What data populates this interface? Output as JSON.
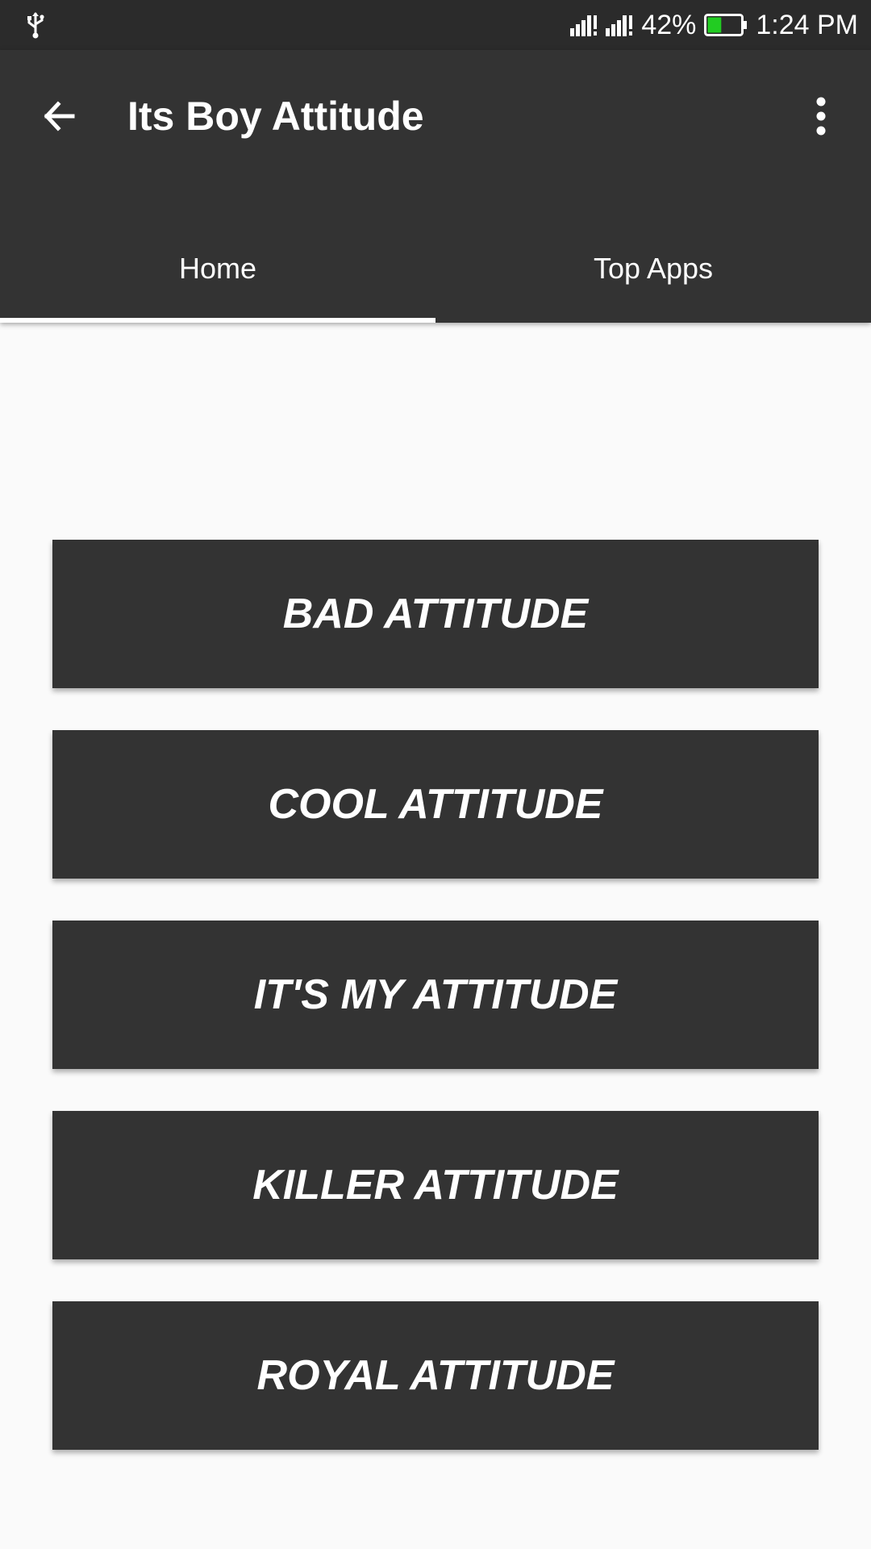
{
  "status_bar": {
    "usb_icon": "usb-icon",
    "signal_icons": [
      "signal-sim1-icon",
      "signal-sim2-icon"
    ],
    "battery_percent": "42%",
    "battery_icon": "battery-icon",
    "battery_level": 0.42,
    "battery_color": "#22cc22",
    "time": "1:24 PM"
  },
  "app_bar": {
    "title": "Its Boy Attitude",
    "back_icon": "arrow-back-icon",
    "menu_icon": "more-vert-icon",
    "background": "#333333"
  },
  "tabs": [
    {
      "label": "Home",
      "selected": true
    },
    {
      "label": "Top Apps",
      "selected": false
    }
  ],
  "buttons": [
    {
      "label": "BAD ATTITUDE"
    },
    {
      "label": "COOL ATTITUDE"
    },
    {
      "label": "IT'S MY ATTITUDE"
    },
    {
      "label": "KILLER ATTITUDE"
    },
    {
      "label": "ROYAL ATTITUDE"
    }
  ]
}
